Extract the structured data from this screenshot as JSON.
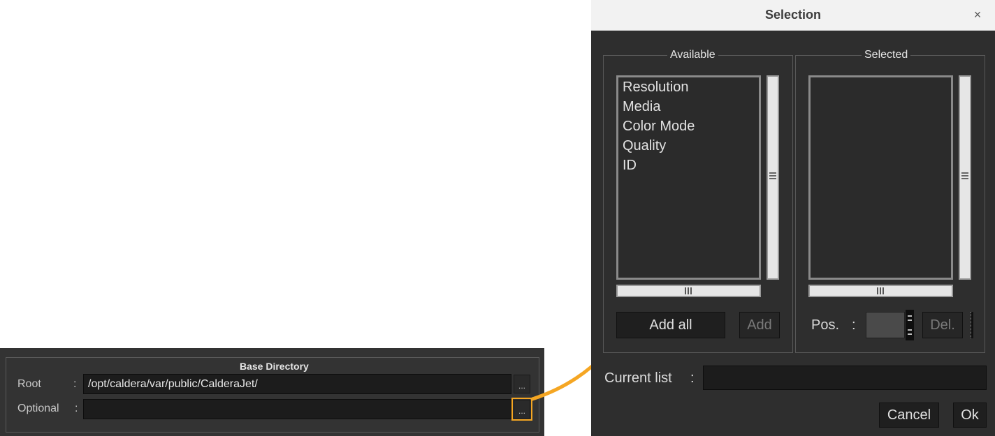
{
  "base_directory": {
    "title": "Base Directory",
    "rows": [
      {
        "label": "Root",
        "colon": ":",
        "value": "/opt/caldera/var/public/CalderaJet/",
        "browse_label": "..."
      },
      {
        "label": "Optional",
        "colon": ":",
        "value": "",
        "browse_label": "..."
      }
    ]
  },
  "annotation": {
    "highlight_color": "#f5a623"
  },
  "dialog": {
    "title": "Selection",
    "close_icon": "×",
    "available": {
      "title": "Available",
      "items": [
        "Resolution",
        "Media",
        "Color Mode",
        "Quality",
        "ID"
      ],
      "add_all_label": "Add all",
      "add_label": "Add"
    },
    "selected": {
      "title": "Selected",
      "items": [],
      "pos_label": "Pos.",
      "pos_colon": ":",
      "pos_value": "",
      "del_label": "Del."
    },
    "current_list": {
      "label": "Current list",
      "colon": ":",
      "value": ""
    },
    "cancel_label": "Cancel",
    "ok_label": "Ok"
  }
}
